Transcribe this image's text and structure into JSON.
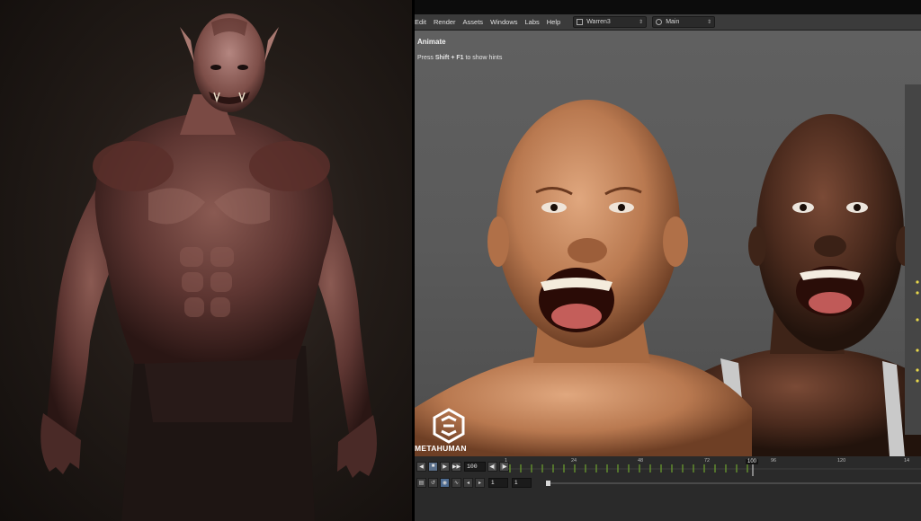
{
  "menu": {
    "items": [
      "Edit",
      "Render",
      "Assets",
      "Windows",
      "Labs",
      "Help"
    ],
    "scene_dropdown": "Warren3",
    "context_dropdown": "Main"
  },
  "viewport": {
    "title": "Animate",
    "hint_prefix": "Press ",
    "hint_keys": "Shift + F1",
    "hint_suffix": " to show hints",
    "logo_text": "METAHUMAN"
  },
  "timeline": {
    "end_frame": "100",
    "ticks": [
      "1",
      "24",
      "48",
      "72",
      "96",
      "120",
      "14"
    ],
    "current_frame": "100",
    "range_start": "1",
    "range_end": "1"
  },
  "icons": {
    "transport": [
      "jump-start-icon",
      "stop-icon",
      "play-icon",
      "jump-end-icon"
    ],
    "step": [
      "step-back-icon",
      "step-forward-icon"
    ]
  },
  "colors": {
    "keyframe": "#6ea32f",
    "viewport_bg": "#5a5a5a",
    "menubar_bg": "#3b3b3b"
  }
}
